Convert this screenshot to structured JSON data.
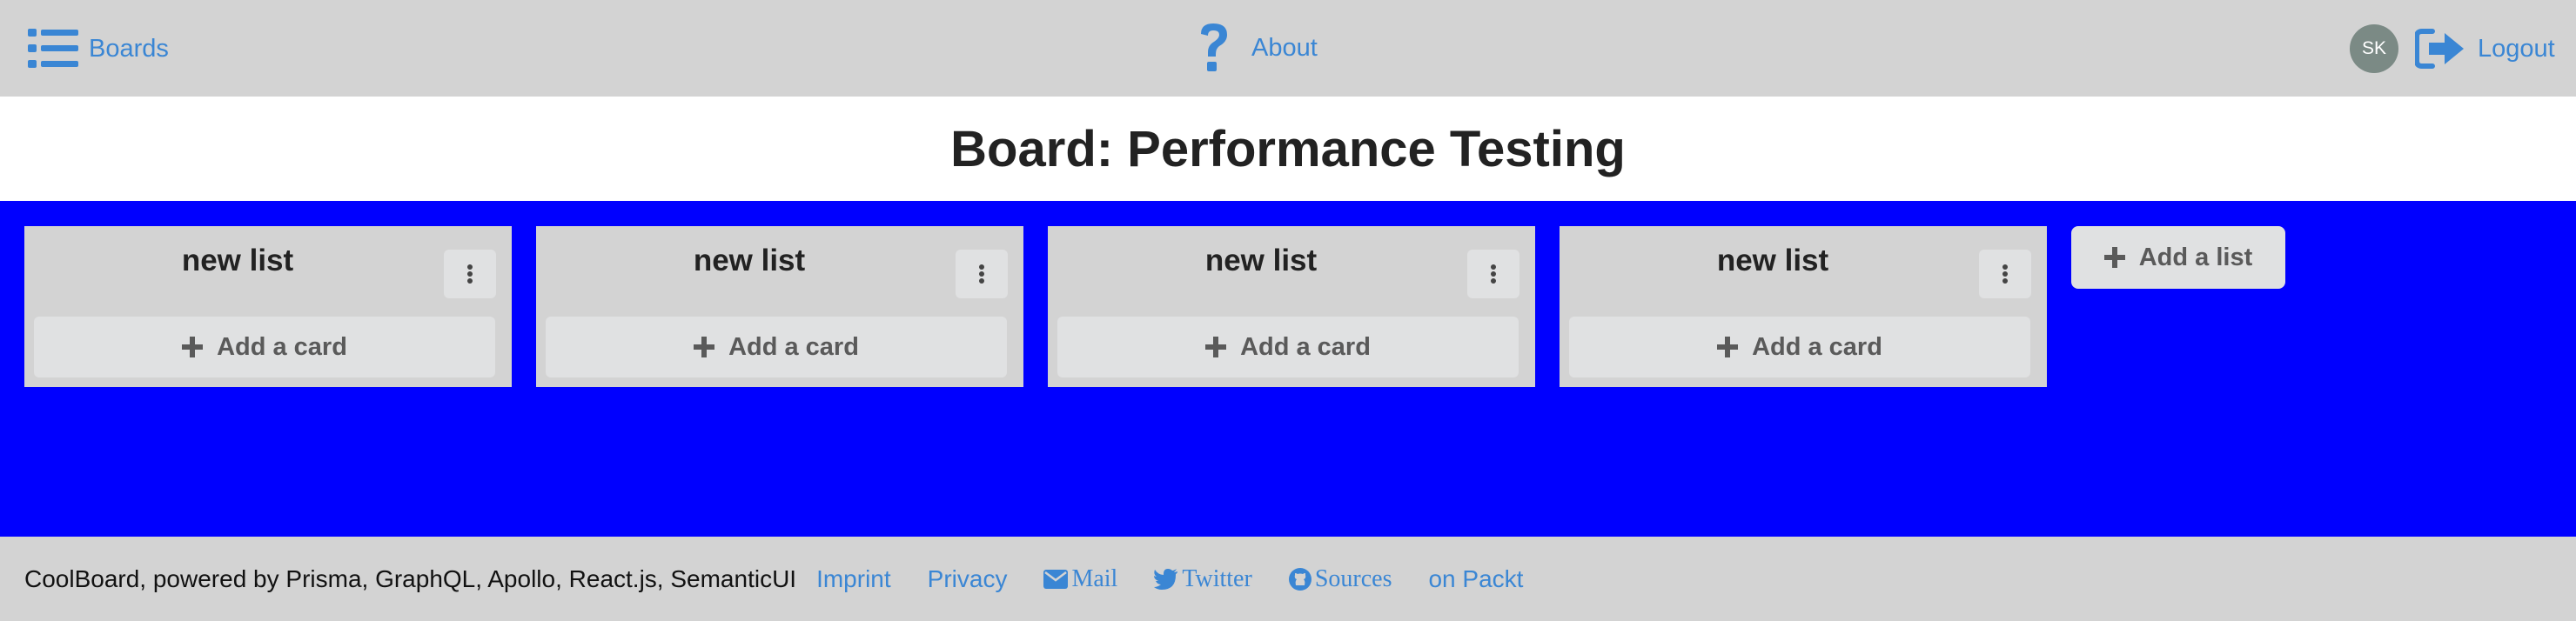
{
  "colors": {
    "accent": "#3a86d4",
    "board_background": "#0000ff",
    "chrome": "#d3d3d3",
    "avatar": "#7b8a85"
  },
  "nav": {
    "boards": {
      "label": "Boards",
      "icon": "list-icon"
    },
    "about": {
      "label": "About",
      "icon": "question-icon"
    },
    "avatar_initials": "SK",
    "logout": {
      "label": "Logout",
      "icon": "sign-out-icon"
    }
  },
  "page": {
    "title": "Board: Performance Testing"
  },
  "board": {
    "lists": [
      {
        "title": "new list",
        "add_card_label": "Add a card"
      },
      {
        "title": "new list",
        "add_card_label": "Add a card"
      },
      {
        "title": "new list",
        "add_card_label": "Add a card"
      },
      {
        "title": "new list",
        "add_card_label": "Add a card"
      }
    ],
    "add_list_label": "Add a list"
  },
  "footer": {
    "text": "CoolBoard, powered by Prisma, GraphQL, Apollo, React.js, SemanticUI",
    "links": {
      "imprint": "Imprint",
      "privacy": "Privacy",
      "mail": "Mail",
      "twitter": "Twitter",
      "sources": "Sources",
      "packt": "on Packt"
    }
  }
}
